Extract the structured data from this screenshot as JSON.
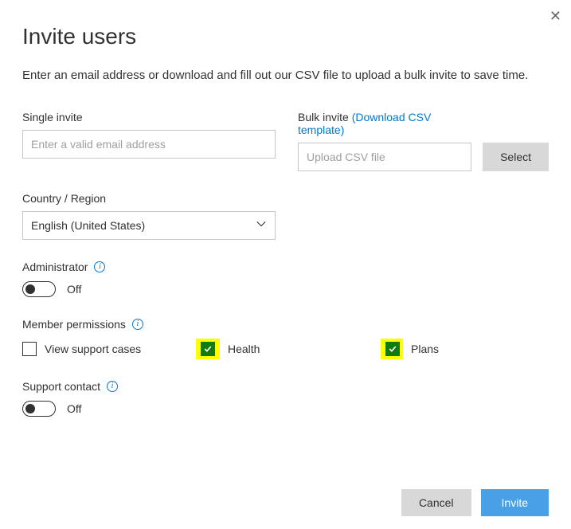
{
  "close_label": "✕",
  "title": "Invite users",
  "intro": "Enter an email address or download and fill out our CSV file to upload a bulk invite to save time.",
  "singleInvite": {
    "label": "Single invite",
    "placeholder": "Enter a valid email address"
  },
  "bulkInvite": {
    "label": "Bulk invite",
    "link": "(Download CSV template)",
    "placeholder": "Upload CSV file",
    "selectBtn": "Select"
  },
  "country": {
    "label": "Country / Region",
    "value": "English (United States)"
  },
  "administrator": {
    "label": "Administrator",
    "state": "Off"
  },
  "memberPermissions": {
    "label": "Member permissions",
    "items": [
      {
        "label": "View support cases",
        "checked": false,
        "highlight": false
      },
      {
        "label": "Health",
        "checked": true,
        "highlight": true
      },
      {
        "label": "Plans",
        "checked": true,
        "highlight": true
      }
    ]
  },
  "supportContact": {
    "label": "Support contact",
    "state": "Off"
  },
  "footer": {
    "cancel": "Cancel",
    "invite": "Invite"
  }
}
